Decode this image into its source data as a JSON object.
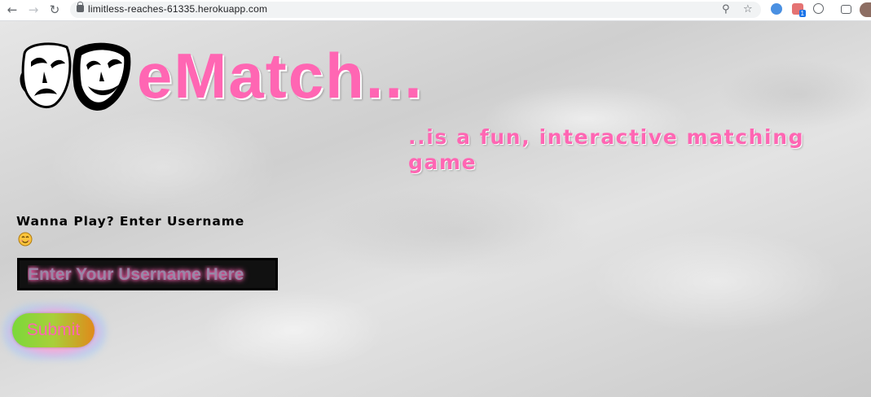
{
  "browser": {
    "url": "limitless-reaches-61335.herokuapp.com",
    "back_icon": "arrow-left-icon",
    "forward_icon": "arrow-right-icon",
    "reload_icon": "reload-icon",
    "lock_icon": "lock-icon",
    "zoom_icon": "zoom-icon",
    "bookmark_icon": "star-icon",
    "extension_badge": "1"
  },
  "app": {
    "title": "eMatch...",
    "tagline": "..is a fun, interactive matching game",
    "logo": "theater-masks-logo",
    "accent_color": "#ff66b3"
  },
  "form": {
    "prompt": "Wanna Play? Enter Username",
    "smiley": "smiley-emoji",
    "username_placeholder": "Enter Your Username Here",
    "username_value": "",
    "submit_label": "Submit"
  }
}
